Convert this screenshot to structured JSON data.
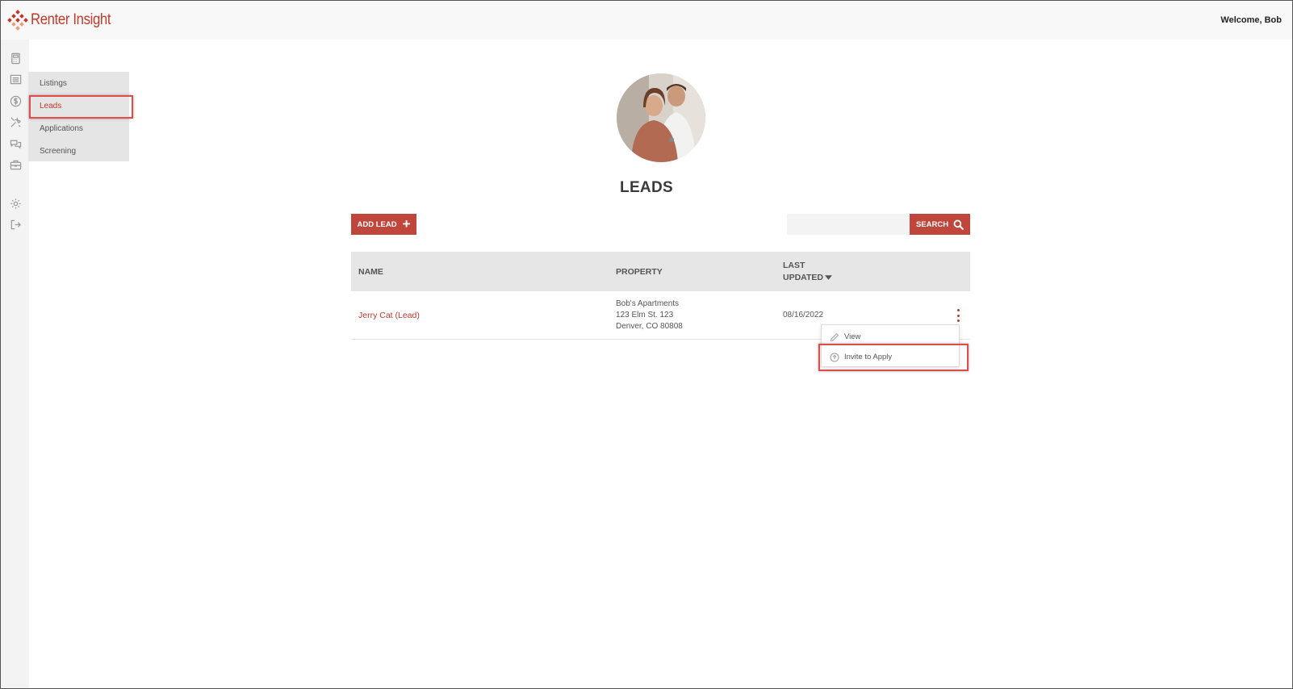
{
  "header": {
    "logo_text": "Renter Insight",
    "welcome": "Welcome, Bob"
  },
  "rail": {
    "icons": [
      "calculator-icon",
      "list-icon",
      "dollar-icon",
      "tools-icon",
      "chat-icon",
      "briefcase-icon",
      "gear-icon",
      "logout-icon"
    ]
  },
  "submenu": {
    "items": [
      {
        "label": "Listings",
        "active": false
      },
      {
        "label": "Leads",
        "active": true
      },
      {
        "label": "Applications",
        "active": false
      },
      {
        "label": "Screening",
        "active": false
      }
    ]
  },
  "page": {
    "title": "LEADS",
    "add_label": "ADD LEAD",
    "search_label": "SEARCH",
    "search_value": ""
  },
  "table": {
    "headers": {
      "name": "NAME",
      "property": "PROPERTY",
      "last": "LAST",
      "updated": "UPDATED"
    },
    "rows": [
      {
        "name": "Jerry Cat (Lead)",
        "property_lines": [
          "Bob's Apartments",
          "123 Elm St. 123",
          "Denver, CO 80808"
        ],
        "updated": "08/16/2022"
      }
    ]
  },
  "dropdown": {
    "items": [
      {
        "label": "View",
        "icon": "pencil-icon"
      },
      {
        "label": "Invite to Apply",
        "icon": "upload-circle-icon"
      }
    ]
  },
  "colors": {
    "accent": "#c0453a",
    "highlight": "#e24b48"
  }
}
